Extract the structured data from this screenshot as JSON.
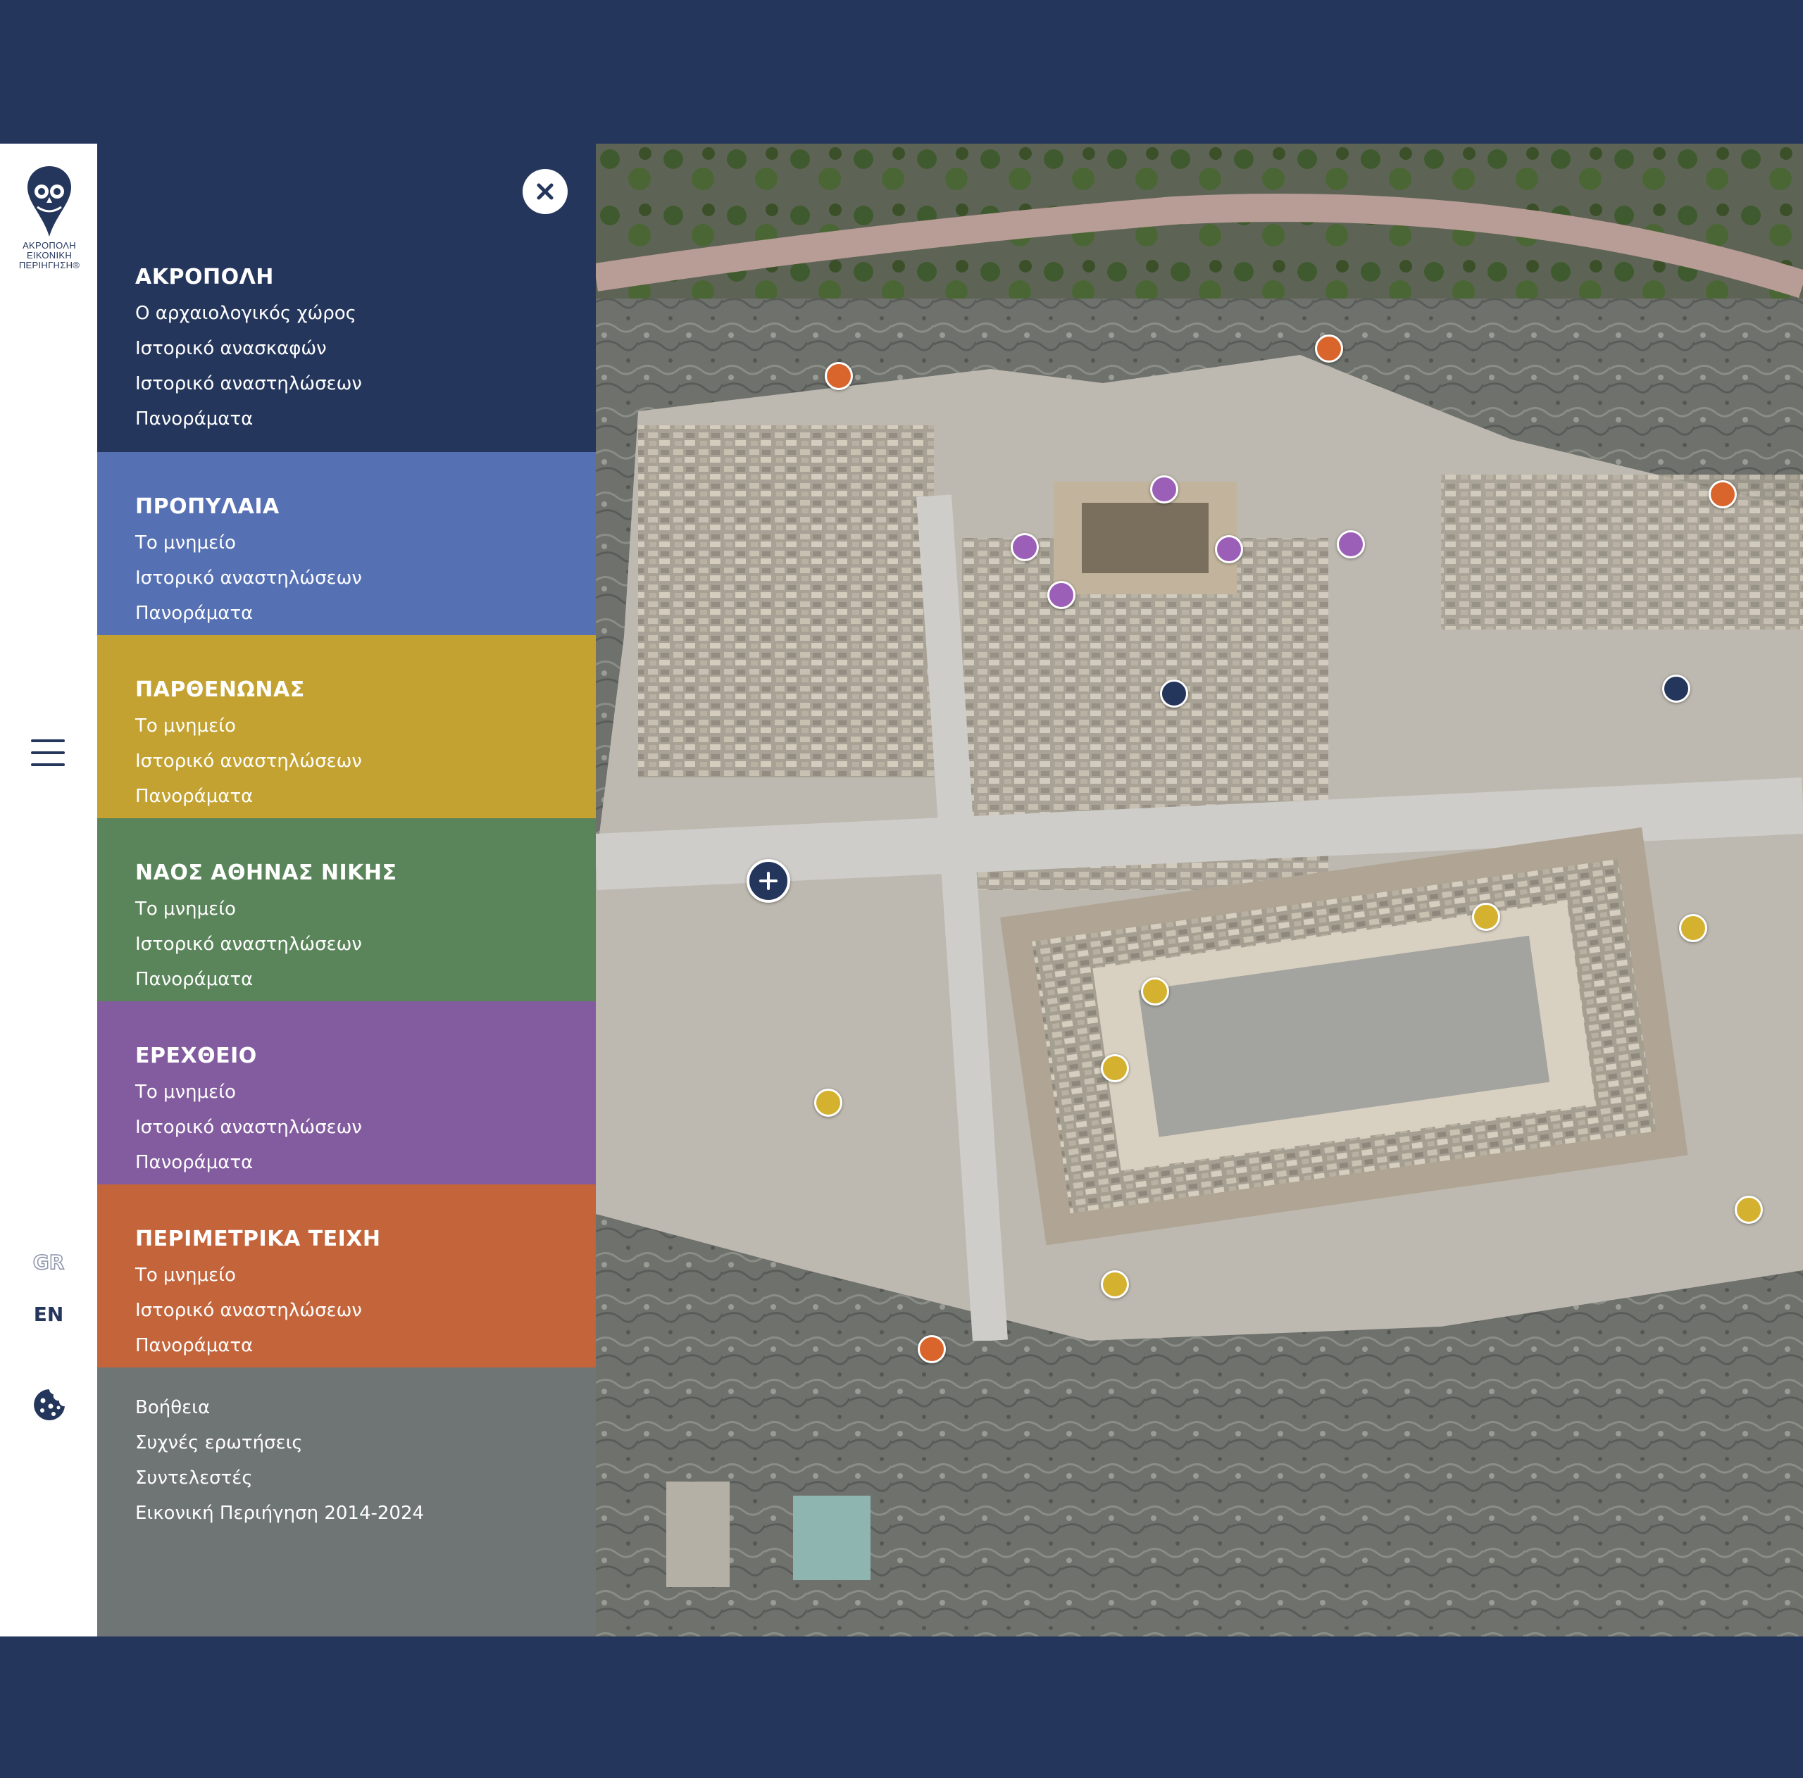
{
  "logo": {
    "lines": [
      "ΑΚΡΟΠΟΛΗ",
      "ΕΙΚΟΝΙΚΗ",
      "ΠΕΡΙΗΓΗΣΗ®"
    ]
  },
  "languages": {
    "gr": "GR",
    "en": "EN",
    "active": "en"
  },
  "menu": {
    "sections": [
      {
        "title": "ΑΚΡΟΠΟΛΗ",
        "color": "#25365c",
        "links": [
          "Ο αρχαιολογικός χώρος",
          "Ιστορικό ανασκαφών",
          "Ιστορικό αναστηλώσεων",
          "Πανοράματα"
        ]
      },
      {
        "title": "ΠΡΟΠΥΛΑΙΑ",
        "color": "#5570b3",
        "links": [
          "Το μνημείο",
          "Ιστορικό αναστηλώσεων",
          "Πανοράματα"
        ]
      },
      {
        "title": "ΠΑΡΘΕΝΩΝΑΣ",
        "color": "#c3a232",
        "links": [
          "Το μνημείο",
          "Ιστορικό αναστηλώσεων",
          "Πανοράματα"
        ]
      },
      {
        "title": "ΝΑΟΣ ΑΘΗΝΑΣ ΝΙΚΗΣ",
        "color": "#5a845a",
        "links": [
          "Το μνημείο",
          "Ιστορικό αναστηλώσεων",
          "Πανοράματα"
        ]
      },
      {
        "title": "ΕΡΕΧΘΕΙΟ",
        "color": "#835c9f",
        "links": [
          "Το μνημείο",
          "Ιστορικό αναστηλώσεων",
          "Πανοράματα"
        ]
      },
      {
        "title": "ΠΕΡΙΜΕΤΡΙΚΑ ΤΕΙΧΗ",
        "color": "#c3643b",
        "links": [
          "Το μνημείο",
          "Ιστορικό αναστηλώσεων",
          "Πανοράματα"
        ]
      }
    ],
    "footer_links": [
      "Βοήθεια",
      "Συχνές ερωτήσεις",
      "Συντελεστές",
      "Εικονική Περιήγηση 2014-2024"
    ]
  },
  "icons": {
    "logo": "owl-pin-icon",
    "menu": "hamburger-icon",
    "close": "close-icon",
    "cookies": "cookie-icon",
    "map_add": "plus-icon"
  },
  "pin_colors": {
    "acropolis": "#25365c",
    "propylaia": "#5570b3",
    "parthenon": "#d4b12f",
    "erechtheion": "#9b5fb8",
    "walls": "#d9642c"
  }
}
